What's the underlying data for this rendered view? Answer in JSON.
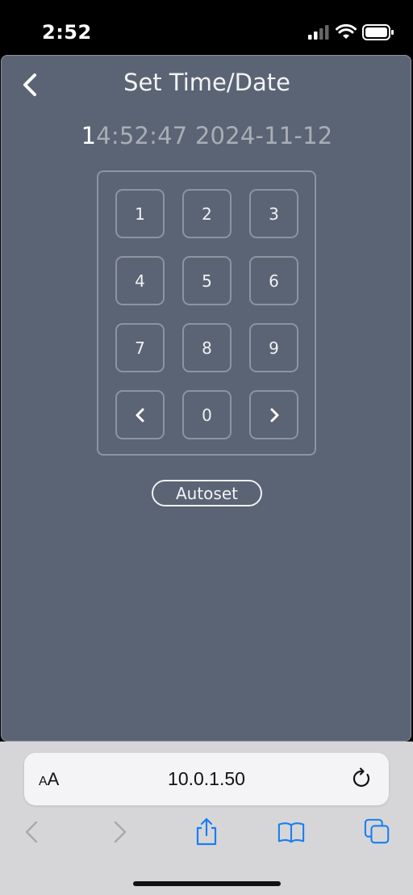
{
  "status_bar": {
    "time": "2:52"
  },
  "app": {
    "title": "Set Time/Date",
    "datetime_cursor_char": "1",
    "datetime_rest": "4:52:47 2024-11-12",
    "keypad": {
      "keys": [
        "1",
        "2",
        "3",
        "4",
        "5",
        "6",
        "7",
        "8",
        "9",
        "0"
      ]
    },
    "autoset_label": "Autoset"
  },
  "browser": {
    "aa_label_small": "A",
    "aa_label_large": "A",
    "url": "10.0.1.50"
  },
  "colors": {
    "app_background": "#5b6474",
    "border": "#8d94a0",
    "text": "#f2f3f5",
    "accent": "#1a7ef0"
  },
  "icons": [
    "signal-icon",
    "wifi-icon",
    "battery-icon",
    "back-chevron-icon",
    "left-arrow-icon",
    "right-arrow-icon",
    "reload-icon",
    "share-icon",
    "bookmarks-icon",
    "tabs-icon"
  ]
}
